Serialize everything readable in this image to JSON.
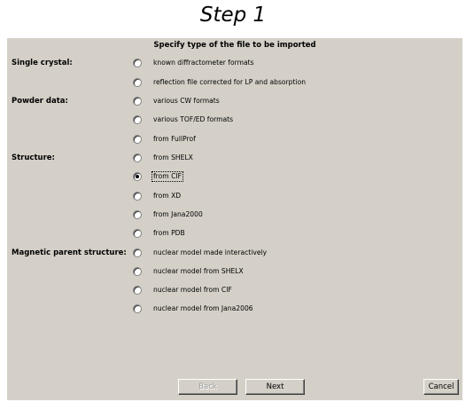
{
  "caption": "Step 1",
  "dialog": {
    "header": "Specify type of the file to be imported",
    "sections": {
      "single_crystal": "Single crystal:",
      "powder": "Powder data:",
      "structure": "Structure:",
      "magnetic": "Magnetic parent structure:"
    },
    "options": [
      {
        "label": "known diffractometer formats",
        "selected": false
      },
      {
        "label": "reflection file corrected for LP and absorption",
        "selected": false
      },
      {
        "label": "various CW formats",
        "selected": false
      },
      {
        "label": "various TOF/ED formats",
        "selected": false
      },
      {
        "label": "from FullProf",
        "selected": false
      },
      {
        "label": "from SHELX",
        "selected": false
      },
      {
        "label": "from CIF",
        "selected": true
      },
      {
        "label": "from XD",
        "selected": false
      },
      {
        "label": "from Jana2000",
        "selected": false
      },
      {
        "label": "from PDB",
        "selected": false
      },
      {
        "label": "nuclear model made interactively",
        "selected": false
      },
      {
        "label": "nuclear model from SHELX",
        "selected": false
      },
      {
        "label": "nuclear model from CIF",
        "selected": false
      },
      {
        "label": "nuclear model from Jana2006",
        "selected": false
      }
    ],
    "buttons": {
      "back": "Back",
      "next": "Next",
      "cancel": "Cancel"
    }
  }
}
